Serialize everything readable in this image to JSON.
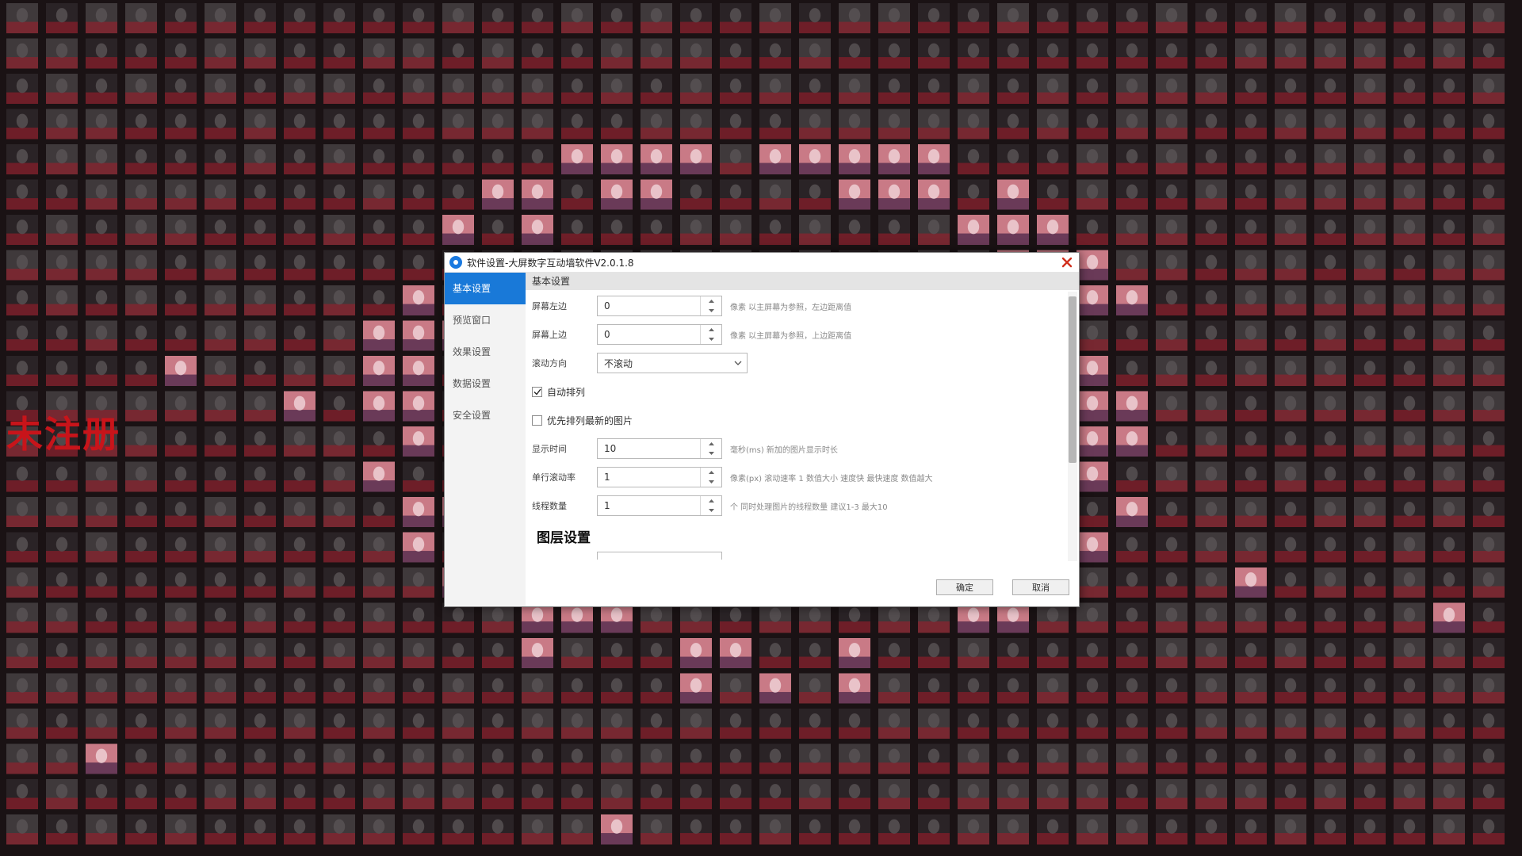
{
  "background": {
    "side_text": "未注册",
    "tile_colors": {
      "base": "#2a2326",
      "dim": "#3f393b",
      "mid": "#5a5456",
      "highlight_top": "#c97a86",
      "highlight_bottom": "#6a3a58",
      "accent_red": "#a51c2a"
    }
  },
  "dialog": {
    "title": "软件设置-大屏数字互动墙软件V2.0.1.8",
    "close_icon": "close-icon",
    "sidebar": {
      "items": [
        {
          "label": "基本设置",
          "active": true
        },
        {
          "label": "预览窗口",
          "active": false
        },
        {
          "label": "效果设置",
          "active": false
        },
        {
          "label": "数据设置",
          "active": false
        },
        {
          "label": "安全设置",
          "active": false
        }
      ]
    },
    "section_title": "基本设置",
    "fields": {
      "left_margin": {
        "label": "屏幕左边",
        "value": "0",
        "hint": "像素  以主屏幕为参照，左边距离值"
      },
      "top_margin": {
        "label": "屏幕上边",
        "value": "0",
        "hint": "像素  以主屏幕为参照，上边距离值"
      },
      "scroll_direction": {
        "label": "滚动方向",
        "value": "不滚动"
      },
      "auto_sort": {
        "label": "自动排列",
        "checked": true
      },
      "priority_sort": {
        "label": "优先排列最新的图片",
        "checked": false
      },
      "display_time": {
        "label": "显示时间",
        "value": "10",
        "hint": "毫秒(ms)  新加的图片显示时长"
      },
      "row_interval": {
        "label": "单行滚动率",
        "value": "1",
        "hint": "像素(px)  滚动速率  1  数值大小  速度快  最快速度  数值越大"
      },
      "thread_count": {
        "label": "线程数量",
        "value": "1",
        "hint": "个  同时处理图片的线程数量  建议1-3  最大10"
      }
    },
    "group_title": "图层设置",
    "buttons": {
      "ok": "确定",
      "cancel": "取消"
    },
    "accent_color": "#1979d8"
  }
}
